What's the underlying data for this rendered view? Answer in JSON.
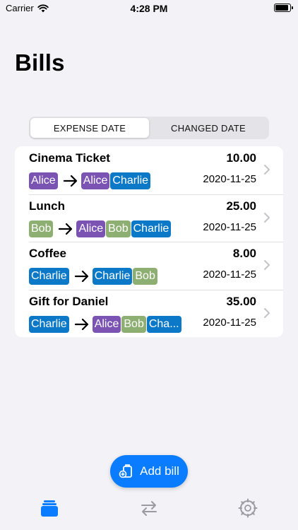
{
  "status_bar": {
    "carrier": "Carrier",
    "time": "4:28 PM",
    "battery_level": 0.9
  },
  "page": {
    "title": "Bills"
  },
  "sort_control": {
    "options": [
      "EXPENSE DATE",
      "CHANGED DATE"
    ],
    "selected": 0
  },
  "colors": {
    "Alice": "#7b53b3",
    "Bob": "#8daf72",
    "Charlie": "#0b79c8",
    "accent": "#0a7cff"
  },
  "bills": [
    {
      "name": "Cinema Ticket",
      "amount": "10.00",
      "date": "2020-11-25",
      "payer": "Alice",
      "participants": [
        "Alice",
        "Charlie"
      ]
    },
    {
      "name": "Lunch",
      "amount": "25.00",
      "date": "2020-11-25",
      "payer": "Bob",
      "participants": [
        "Alice",
        "Bob",
        "Charlie"
      ]
    },
    {
      "name": "Coffee",
      "amount": "8.00",
      "date": "2020-11-25",
      "payer": "Charlie",
      "participants": [
        "Charlie",
        "Bob"
      ]
    },
    {
      "name": "Gift for Daniel",
      "amount": "35.00",
      "date": "2020-11-25",
      "payer": "Charlie",
      "participants": [
        "Alice",
        "Bob",
        "Cha..."
      ]
    }
  ],
  "add_bill": {
    "label": "Add bill"
  },
  "tabs": [
    {
      "icon": "bills-stack-icon",
      "active": true
    },
    {
      "icon": "transfer-arrows-icon",
      "active": false
    },
    {
      "icon": "settings-gear-icon",
      "active": false
    }
  ]
}
